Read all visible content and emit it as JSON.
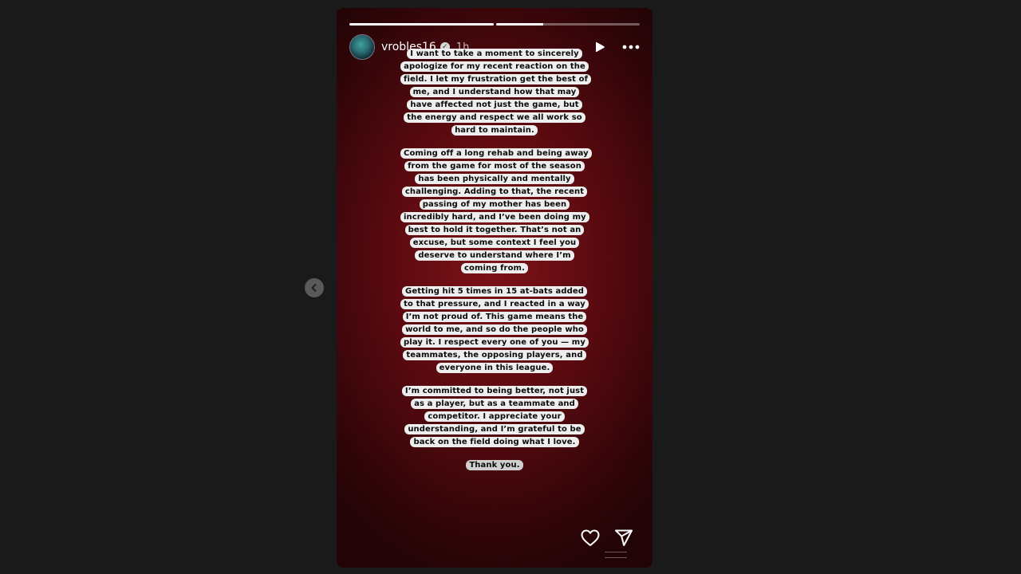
{
  "story": {
    "progress": [
      1.0,
      0.33
    ],
    "username": "vrobles16",
    "time": "1h",
    "paragraphs": [
      "I want to take a moment to sincerely apologize for my recent reaction on the field. I let my frustration get the best of me, and I understand how that may have affected not just the game, but the energy and respect we all work so hard to maintain.",
      "Coming off a long rehab and being away from the game for most of the season has been physically and mentally challenging. Adding to that, the recent passing of my mother has been incredibly hard, and I’ve been doing my best to hold it together. That’s not an excuse, but some context I feel you deserve to understand where I’m coming from.",
      "Getting hit 5 times in 15 at-bats added to that pressure, and I reacted in a way I’m not proud of. This game means the world to me, and so do the people who play it. I respect every one of you — my teammates, the opposing players, and everyone in this league.",
      "I’m committed to being better, not just as a player, but as a teammate and competitor. I appreciate your understanding, and I’m grateful to be back on the field doing what I love.",
      "Thank you."
    ]
  },
  "icons": {
    "verified": "verified-badge-icon",
    "play": "play-icon",
    "more": "more-options-icon",
    "like": "heart-icon",
    "share": "send-icon",
    "prev": "chevron-left-icon"
  },
  "colors": {
    "page_bg": "#1a1a1a",
    "story_bg": "#6a0d14",
    "sticker_bg": "#eeeeee"
  }
}
